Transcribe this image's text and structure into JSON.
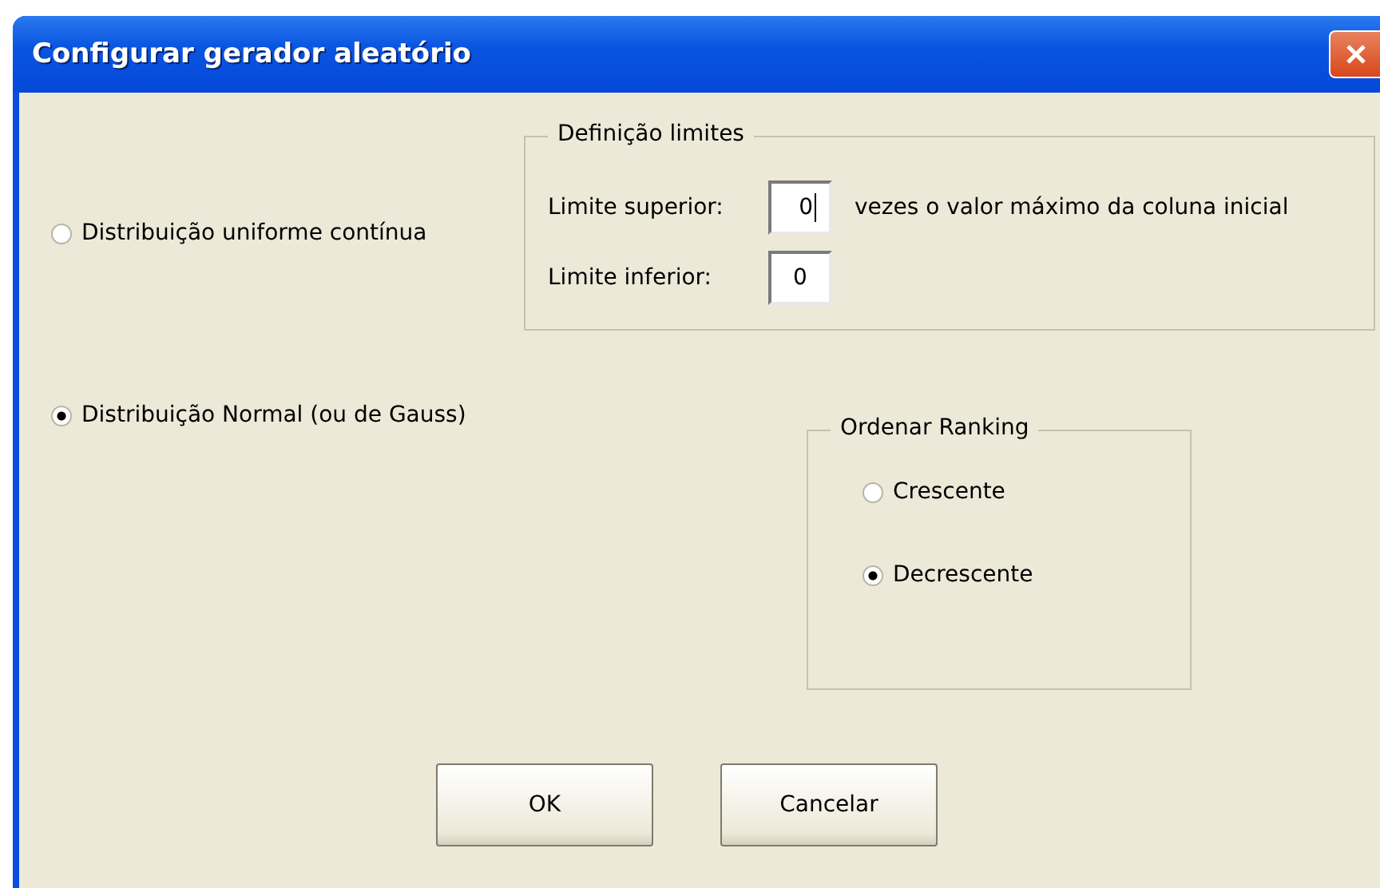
{
  "window": {
    "title": "Configurar gerador aleatório"
  },
  "distributions": [
    {
      "label": "Distribuição uniforme contínua",
      "selected": false
    },
    {
      "label": "Distribuição Normal (ou de Gauss)",
      "selected": true
    }
  ],
  "limits": {
    "title": "Definição limites",
    "fields": [
      {
        "label": "Limite superior:",
        "value": "0",
        "focused": true,
        "suffix": "vezes o valor máximo da coluna inicial"
      },
      {
        "label": "Limite inferior:",
        "value": "0",
        "focused": false
      }
    ]
  },
  "ranking": {
    "title": "Ordenar Ranking",
    "options": [
      {
        "label": "Crescente",
        "selected": false
      },
      {
        "label": "Decrescente",
        "selected": true
      }
    ]
  },
  "buttons": [
    "OK",
    "Cancelar"
  ]
}
